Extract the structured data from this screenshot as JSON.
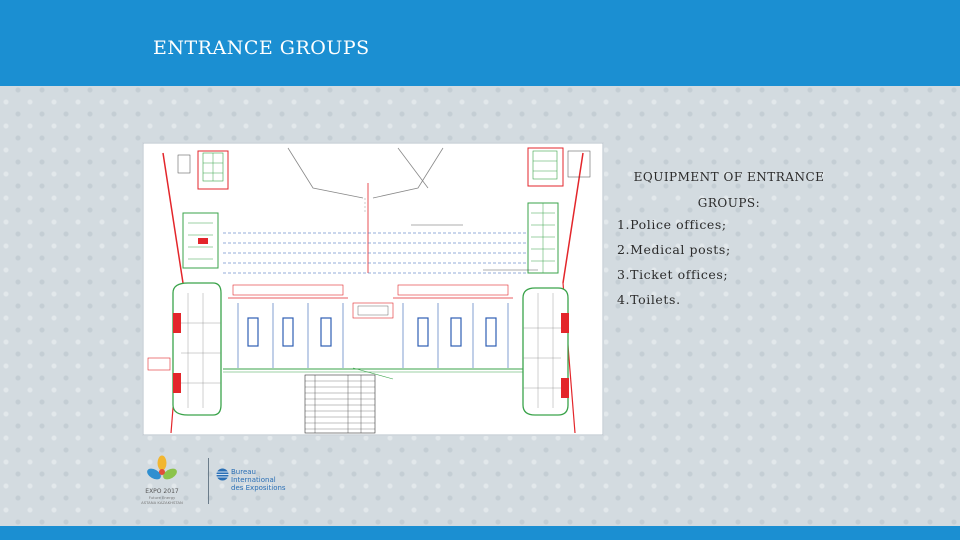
{
  "header": {
    "title": "ENTRANCE GROUPS"
  },
  "info": {
    "heading": "EQUIPMENT OF ENTRANCE GROUPS:",
    "items": [
      {
        "number": "1.",
        "text": "Police offices;"
      },
      {
        "number": "2.",
        "text": "Medical posts;"
      },
      {
        "number": "3.",
        "text": "Ticket offices;"
      },
      {
        "number": "4.",
        "text": "Toilets."
      }
    ]
  },
  "footer": {
    "expo_logo": {
      "name": "EXPO 2017",
      "subtitle": "Future Energy",
      "subtitle2": "ASTANA KAZAKHSTAN"
    },
    "bie_logo": {
      "line1": "Bureau",
      "line2": "International",
      "line3": "des Expositions"
    }
  },
  "colors": {
    "header_blue": "#1b8fd2",
    "background": "#d3dbe0",
    "plan_red": "#e3262b",
    "plan_green": "#3aa34a",
    "plan_blue": "#2f5fb3"
  },
  "icons": [
    "expo-2017-logo-icon",
    "bie-globe-icon"
  ]
}
